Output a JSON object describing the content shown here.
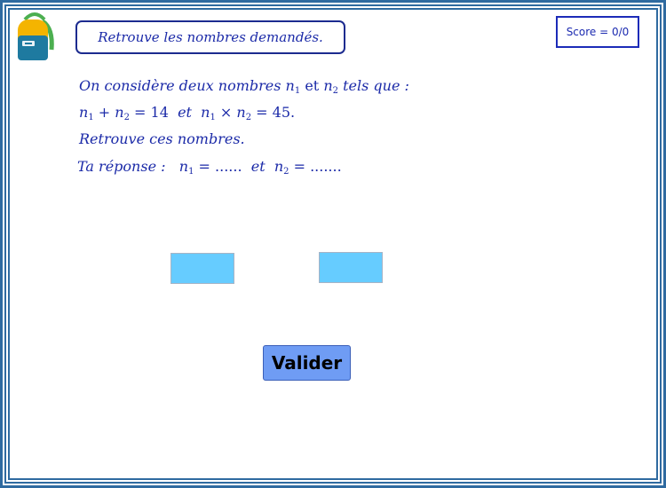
{
  "header": {
    "title": "Retrouve les nombres demandés.",
    "score_label": "Score = 0/0"
  },
  "problem": {
    "line1_pre": "On considère deux nombres ",
    "var_n": "n",
    "sub1": "1",
    "sub2": "2",
    "line1_mid": " et ",
    "line1_post": " tels que :",
    "line2_sum": " = 14",
    "line2_mid": "  et  ",
    "line2_prod": " = 45.",
    "plus": " + ",
    "times": " × ",
    "line3": "Retrouve ces nombres."
  },
  "answer": {
    "prefix": "Ta réponse :",
    "n1_blank": " = ......",
    "connector": "  et  ",
    "n2_blank": " = ......."
  },
  "inputs": {
    "n1_value": "",
    "n2_value": ""
  },
  "actions": {
    "validate_label": "Valider"
  },
  "colors": {
    "frame": "#2f6aa0",
    "text_blue": "#1b2aa8",
    "input_fill": "#66ccff",
    "button_fill": "#6f9cf4"
  },
  "icons": {
    "logo": "backpack-icon"
  }
}
